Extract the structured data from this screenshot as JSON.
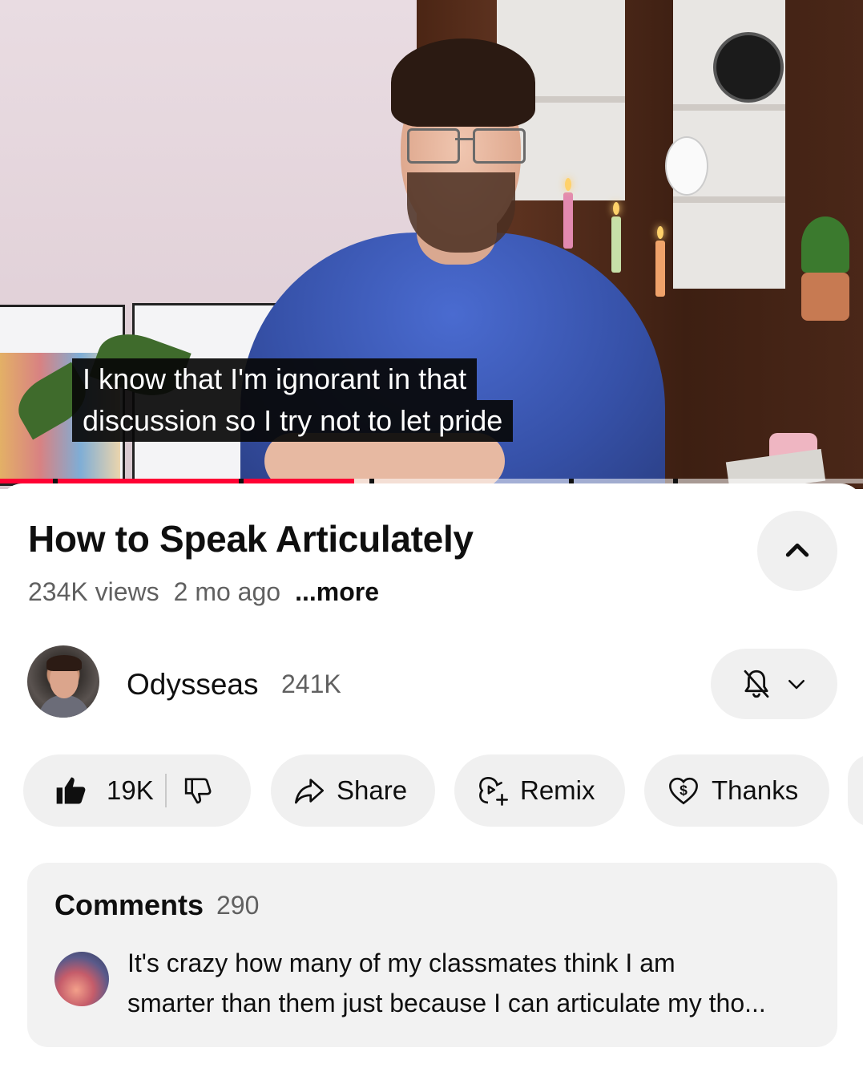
{
  "video": {
    "caption_line1": "I know that I'm ignorant in that",
    "caption_line2": "discussion so I try not to let pride",
    "progress_fraction": 0.41,
    "progress_color": "#ff0033"
  },
  "details": {
    "title": "How to Speak Articulately",
    "views": "234K views",
    "age": "2 mo ago",
    "more_label": "...more",
    "collapse_icon": "chevron-up-icon"
  },
  "channel": {
    "name": "Odysseas",
    "subscribers": "241K",
    "notification_icon": "bell-off-icon",
    "dropdown_icon": "chevron-down-icon"
  },
  "actions": {
    "like_count": "19K",
    "like_icon": "thumbs-up-filled-icon",
    "dislike_icon": "thumbs-down-icon",
    "share_label": "Share",
    "remix_label": "Remix",
    "thanks_label": "Thanks"
  },
  "comments": {
    "title": "Comments",
    "count": "290",
    "top_comment_line1": "It's crazy how many of my classmates think I am",
    "top_comment_line2": "smarter than them just because I can articulate my tho..."
  }
}
